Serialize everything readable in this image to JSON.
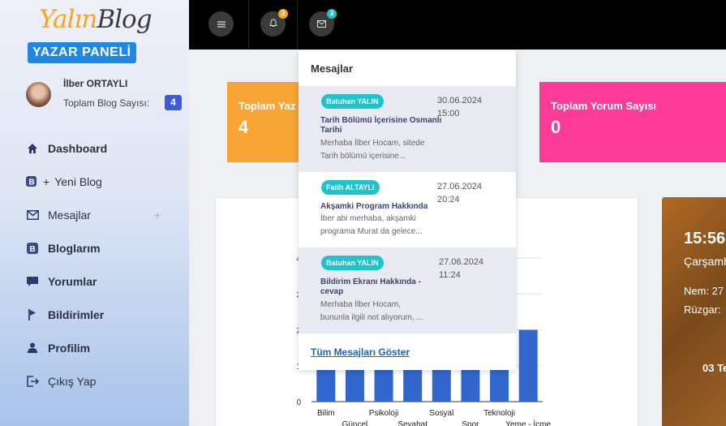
{
  "brand": {
    "logo_part1": "Yalın",
    "logo_part2": "Blog",
    "panel": "YAZAR PANELİ"
  },
  "user": {
    "name": "İlber ORTAYLI",
    "blog_count_label": "Toplam Blog Sayısı:",
    "blog_count": "4"
  },
  "nav": [
    {
      "label": "Dashboard",
      "icon": "home-icon"
    },
    {
      "label": "Yeni Blog",
      "icon": "new-blog-icon"
    },
    {
      "label": "Mesajlar",
      "icon": "mail-icon",
      "extra": "+"
    },
    {
      "label": "Bloglarım",
      "icon": "blogger-icon"
    },
    {
      "label": "Yorumlar",
      "icon": "comment-icon"
    },
    {
      "label": "Bildirimler",
      "icon": "flag-icon"
    },
    {
      "label": "Profilim",
      "icon": "user-icon"
    },
    {
      "label": "Çıkış Yap",
      "icon": "logout-icon"
    }
  ],
  "topbar": {
    "notif_count": "3",
    "mail_count": "3"
  },
  "cards": [
    {
      "title": "Toplam Yaz",
      "value": "4",
      "color": "#f7a534"
    },
    {
      "title": "Toplam Yorum Sayısı",
      "value": "0",
      "color": "#ff3b9a"
    }
  ],
  "chart_data": {
    "type": "bar",
    "categories": [
      "Bilim",
      "Güncel",
      "Psikoloji",
      "Seyahat",
      "Sosyal",
      "Spor",
      "Teknoloji",
      "Yeme - İçme"
    ],
    "values": [
      1,
      1,
      1,
      1,
      1,
      1,
      1,
      2
    ],
    "y_ticks": [
      "0",
      "1",
      "2",
      "3",
      "4"
    ],
    "ylim": [
      0,
      4
    ],
    "color": "#3366cc"
  },
  "weather": {
    "time": "15:56",
    "day": "Çarşamb",
    "humidity": "Nem: 27",
    "wind": "Rüzgar:",
    "date": "03 Te"
  },
  "messages": {
    "title": "Mesajlar",
    "show_all": "Tüm Mesajları Göster",
    "items": [
      {
        "sender": "Batuhan YALIN",
        "date": "30.06.2024",
        "time": "15:00",
        "subject": "Tarih Bölümü İçerisine Osmanlı Tarihi",
        "line1": "Merhaba İlber Hocam, sitede",
        "line2": "Tarih bölümü içerisine..."
      },
      {
        "sender": "Fatih ALTAYLI",
        "date": "27.06.2024",
        "time": "20:24",
        "subject": "Akşamki Program Hakkında",
        "line1": "İber abi merhaba, akşamki",
        "line2": "programa Murat da gelece..."
      },
      {
        "sender": "Batuhan YALIN",
        "date": "27.06.2024",
        "time": "11:24",
        "subject": "Bildirim Ekranı Hakkında - cevap",
        "line1": "Merhaba İlber Hocam,",
        "line2": "bununla ilgili not alıyorum, ..."
      }
    ]
  }
}
